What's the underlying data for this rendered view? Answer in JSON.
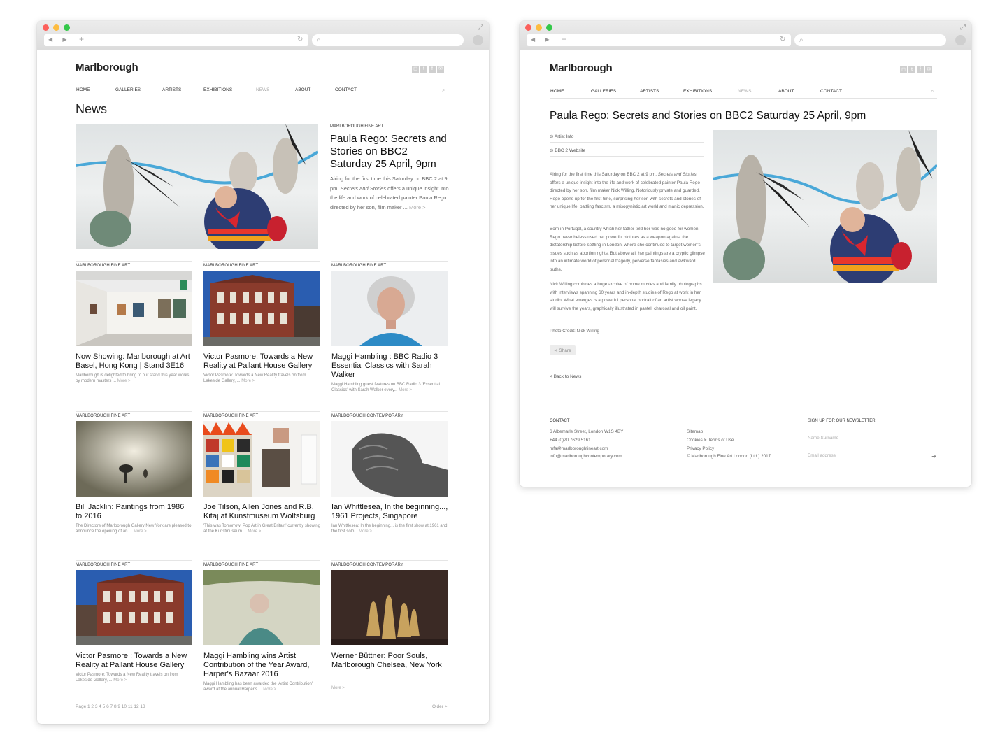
{
  "site": {
    "logo": "Marlborough",
    "nav": [
      "HOME",
      "GALLERIES",
      "ARTISTS",
      "EXHIBITIONS",
      "NEWS",
      "ABOUT",
      "CONTACT"
    ],
    "social_icons": [
      "instagram-icon",
      "twitter-icon",
      "facebook-icon",
      "mail-icon"
    ]
  },
  "browser": {
    "new_tab": "+",
    "back_forward": "◀ ▶"
  },
  "news_page": {
    "heading": "News",
    "featured": {
      "category": "MARLBOROUGH FINE ART",
      "title": "Paula Rego: Secrets and Stories on BBC2 Saturday 25 April, 9pm",
      "excerpt_a": "Airing for the first time this Saturday on BBC 2 at 9 pm, ",
      "excerpt_em": "Secrets and Stories",
      "excerpt_b": " offers a unique insight into the life and work of celebrated painter Paula Rego directed by her son, film maker ...",
      "more": "More >"
    },
    "cards": [
      {
        "category": "MARLBOROUGH FINE ART",
        "title": "Now Showing: Marlborough at Art Basel, Hong Kong | Stand 3E16",
        "excerpt": "Marlborough is delighted to bring to our stand this year works by modern masters ...",
        "more": "More >"
      },
      {
        "category": "MARLBOROUGH FINE ART",
        "title": "Victor Pasmore: Towards a New Reality at Pallant House Gallery",
        "excerpt": "Victor Pasmore: Towards a New Reality travels on from Lakeside Gallery, ...",
        "more": "More >"
      },
      {
        "category": "MARLBOROUGH FINE ART",
        "title": "Maggi Hambling : BBC Radio 3 Essential Classics with Sarah Walker",
        "excerpt": "Maggi Hambling guest features on BBC Radio 3 'Essential Classics' with Sarah Walker every...",
        "more": "More >"
      },
      {
        "category": "MARLBOROUGH FINE ART",
        "title": "Bill Jacklin: Paintings from 1986 to 2016",
        "excerpt": "The Directors of Marlborough Gallery New York are pleased to announce the opening of an ...",
        "more": "More >"
      },
      {
        "category": "MARLBOROUGH FINE ART",
        "title": "Joe Tilson, Allen Jones and R.B. Kitaj at Kunstmuseum Wolfsburg",
        "excerpt": "'This was Tomorrow: Pop Art in Great Britain' currently showing at the Kunstmuseum ...",
        "more": "More >"
      },
      {
        "category": "MARLBOROUGH CONTEMPORARY",
        "title": "Ian Whittlesea, In the beginning..., 1961 Projects, Singapore",
        "excerpt": "Ian Whittlesea: In the beginning... is the first show at 1961 and the first solo...",
        "more": "More >"
      },
      {
        "category": "MARLBOROUGH FINE ART",
        "title": "Victor Pasmore : Towards a New Reality at Pallant House Gallery",
        "excerpt": "Victor Pasmore: Towards a New Reality travels on from Lakeside Gallery, ...",
        "more": "More >"
      },
      {
        "category": "MARLBOROUGH FINE ART",
        "title": "Maggi Hambling wins Artist Contribution of the Year Award, Harper's Bazaar 2016",
        "excerpt": "Maggi Hambling has been awarded the 'Artist Contribution' award at the annual Harper's ...",
        "more": "More >"
      },
      {
        "category": "MARLBOROUGH CONTEMPORARY",
        "title": "Werner Büttner: Poor Souls, Marlborough Chelsea, New York",
        "excerpt": "...",
        "more": "More >"
      }
    ],
    "pager_label": "Page",
    "pager_pages": "1 2 3 4 5 6 7 8 9 10 11 12 13",
    "older": "Older >"
  },
  "article_page": {
    "title": "Paula Rego: Secrets and Stories on BBC2 Saturday 25 April, 9pm",
    "links": [
      "Artist Info",
      "BBC 2 Website"
    ],
    "p1_a": "Airing for the first time this Saturday on BBC 2 at 9 pm, ",
    "p1_em": "Secrets and Stories",
    "p1_b": " offers a unique insight into the life and work of celebrated painter Paula Rego directed by her son, film maker Nick Willing. Notoriously private and guarded, Rego opens up for the first time, surprising her son with secrets and stories of her unique life, battling fascism, a misogynistic art world and manic depression.",
    "p2": "Born in Portugal, a country which her father told her was no good for women, Rego nevertheless used her powerful pictures as a weapon against the dictatorship before settling in London, where she continued to target women's issues such as abortion rights. But above all, her paintings are a cryptic glimpse into an intimate world of personal tragedy, perverse fantasies and awkward truths.",
    "p3": "Nick Willing combines a huge archive of home movies and family photographs with interviews spanning 60 years and in-depth studies of Rego at work in her studio. What emerges is a powerful personal portrait of an artist whose legacy will survive the years, graphically illustrated in pastel, charcoal and oil paint.",
    "credit": "Photo Credit: Nick Willing",
    "share": "Share",
    "back": "< Back to News",
    "footer": {
      "contact_heading": "CONTACT",
      "contact_lines": [
        "6 Albemarle Street, London W1S 4BY",
        "+44 (0)20 7629 5161",
        "mfa@marlboroughfineart.com",
        "info@marlboroughcontemporary.com"
      ],
      "links": [
        "Sitemap",
        "Cookies & Terms of Use",
        "Privacy Policy",
        "© Marlborough Fine Art London (Ltd.) 2017"
      ],
      "newsletter_heading": "SIGN UP FOR OUR NEWSLETTER",
      "name_placeholder": "Name Surname",
      "email_placeholder": "Email address"
    }
  },
  "colors": {
    "dot_red": "#fc605b",
    "dot_yellow": "#fdbc40",
    "dot_green": "#34c84a"
  }
}
